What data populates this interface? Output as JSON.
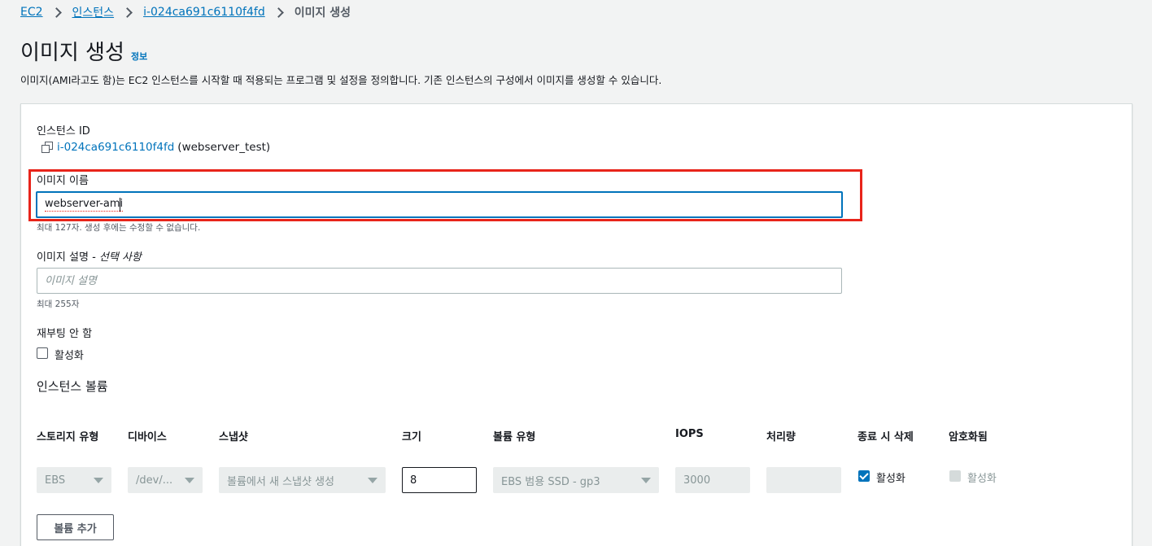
{
  "breadcrumb": {
    "items": [
      "EC2",
      "인스턴스",
      "i-024ca691c6110f4fd"
    ],
    "current": "이미지 생성"
  },
  "header": {
    "title": "이미지 생성",
    "info": "정보",
    "description": "이미지(AMI라고도 함)는 EC2 인스턴스를 시작할 때 적용되는 프로그램 및 설정을 정의합니다. 기존 인스턴스의 구성에서 이미지를 생성할 수 있습니다."
  },
  "instance": {
    "label": "인스턴스 ID",
    "id": "i-024ca691c6110f4fd",
    "name": "(webserver_test)"
  },
  "image_name": {
    "label": "이미지 이름",
    "value": "webserver-ami",
    "hint": "최대 127자. 생성 후에는 수정할 수 없습니다."
  },
  "image_description": {
    "label": "이미지 설명",
    "optional": " - 선택 사항",
    "placeholder": "이미지 설명",
    "hint": "최대 255자"
  },
  "no_reboot": {
    "label": "재부팅 안 함",
    "checkbox_label": "활성화",
    "checked": false
  },
  "volumes": {
    "title": "인스턴스 볼륨",
    "columns": [
      "스토리지 유형",
      "디바이스",
      "스냅샷",
      "크기",
      "볼륨 유형",
      "IOPS",
      "처리량",
      "종료 시 삭제",
      "암호화됨"
    ],
    "row": {
      "storage_type": "EBS",
      "device": "/dev/...",
      "snapshot": "볼륨에서 새 스냅샷 생성",
      "size": "8",
      "volume_type": "EBS 범용 SSD - gp3",
      "iops": "3000",
      "throughput": "",
      "delete_on_termination": "활성화",
      "delete_on_termination_checked": true,
      "encrypted": "활성화",
      "encrypted_checked": false
    },
    "add_button": "볼륨 추가"
  },
  "colors": {
    "link": "#0073bb",
    "highlight": "#e8241a",
    "background": "#f2f3f3"
  }
}
